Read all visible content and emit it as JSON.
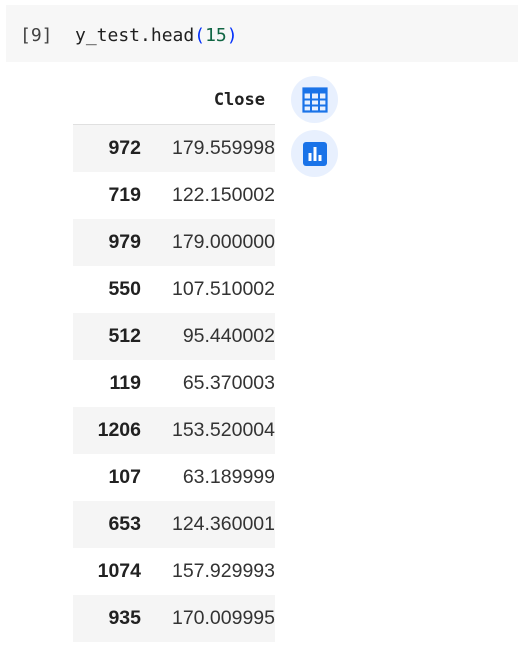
{
  "cell": {
    "execution_count": "[9]",
    "code": {
      "prefix": "y_test.head",
      "open_paren": "(",
      "arg": "15",
      "close_paren": ")"
    }
  },
  "output": {
    "column_header": "Close",
    "rows": [
      {
        "index": "972",
        "value": "179.559998"
      },
      {
        "index": "719",
        "value": "122.150002"
      },
      {
        "index": "979",
        "value": "179.000000"
      },
      {
        "index": "550",
        "value": "107.510002"
      },
      {
        "index": "512",
        "value": "95.440002"
      },
      {
        "index": "119",
        "value": "65.370003"
      },
      {
        "index": "1206",
        "value": "153.520004"
      },
      {
        "index": "107",
        "value": "63.189999"
      },
      {
        "index": "653",
        "value": "124.360001"
      },
      {
        "index": "1074",
        "value": "157.929993"
      },
      {
        "index": "935",
        "value": "170.009995"
      }
    ]
  },
  "toolbar": {
    "table_icon": "table-icon",
    "chart_icon": "bar-chart-icon",
    "accent_color": "#1a73e8",
    "button_bg": "#e8f0fe"
  }
}
